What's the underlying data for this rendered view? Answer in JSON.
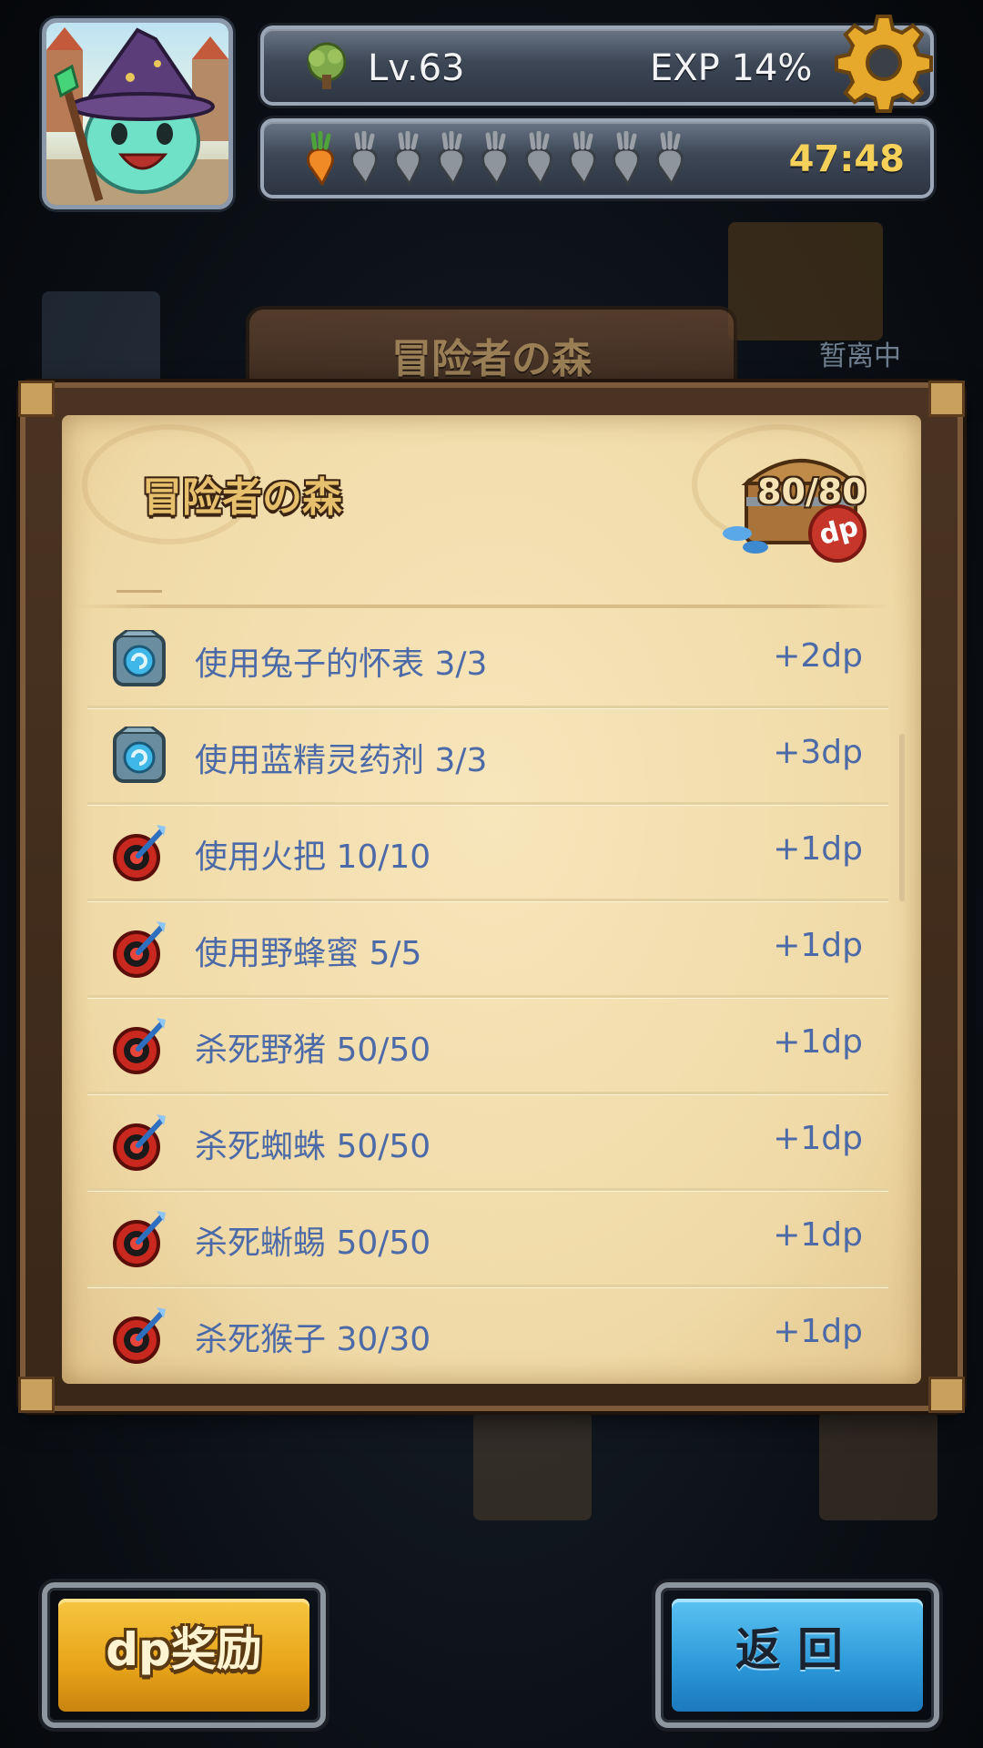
{
  "player": {
    "level_label": "Lv.63",
    "exp_label": "EXP 14%",
    "timer": "47:48",
    "stamina": {
      "filled": 1,
      "total": 9
    }
  },
  "background": {
    "area_sign": "冒险者の森",
    "away_label": "暂离中"
  },
  "panel": {
    "title": "冒险者の森",
    "dp_total": "80/80",
    "dp_badge": "dp"
  },
  "quests": [
    {
      "icon": "portal-icon",
      "label": "使用兔子的怀表 3/3",
      "reward": "+2dp"
    },
    {
      "icon": "portal-icon",
      "label": "使用蓝精灵药剂 3/3",
      "reward": "+3dp"
    },
    {
      "icon": "target-icon",
      "label": "使用火把 10/10",
      "reward": "+1dp"
    },
    {
      "icon": "target-icon",
      "label": "使用野蜂蜜 5/5",
      "reward": "+1dp"
    },
    {
      "icon": "target-icon",
      "label": "杀死野猪 50/50",
      "reward": "+1dp"
    },
    {
      "icon": "target-icon",
      "label": "杀死蜘蛛 50/50",
      "reward": "+1dp"
    },
    {
      "icon": "target-icon",
      "label": "杀死蜥蜴 50/50",
      "reward": "+1dp"
    },
    {
      "icon": "target-icon",
      "label": "杀死猴子 30/30",
      "reward": "+1dp"
    }
  ],
  "buttons": {
    "dp_reward": "dp奖励",
    "back": "返回"
  },
  "colors": {
    "quest_text": "#4c6aa8",
    "timer": "#f6d15a",
    "dp_button": "#e8a419",
    "back_button": "#2b98d9"
  }
}
